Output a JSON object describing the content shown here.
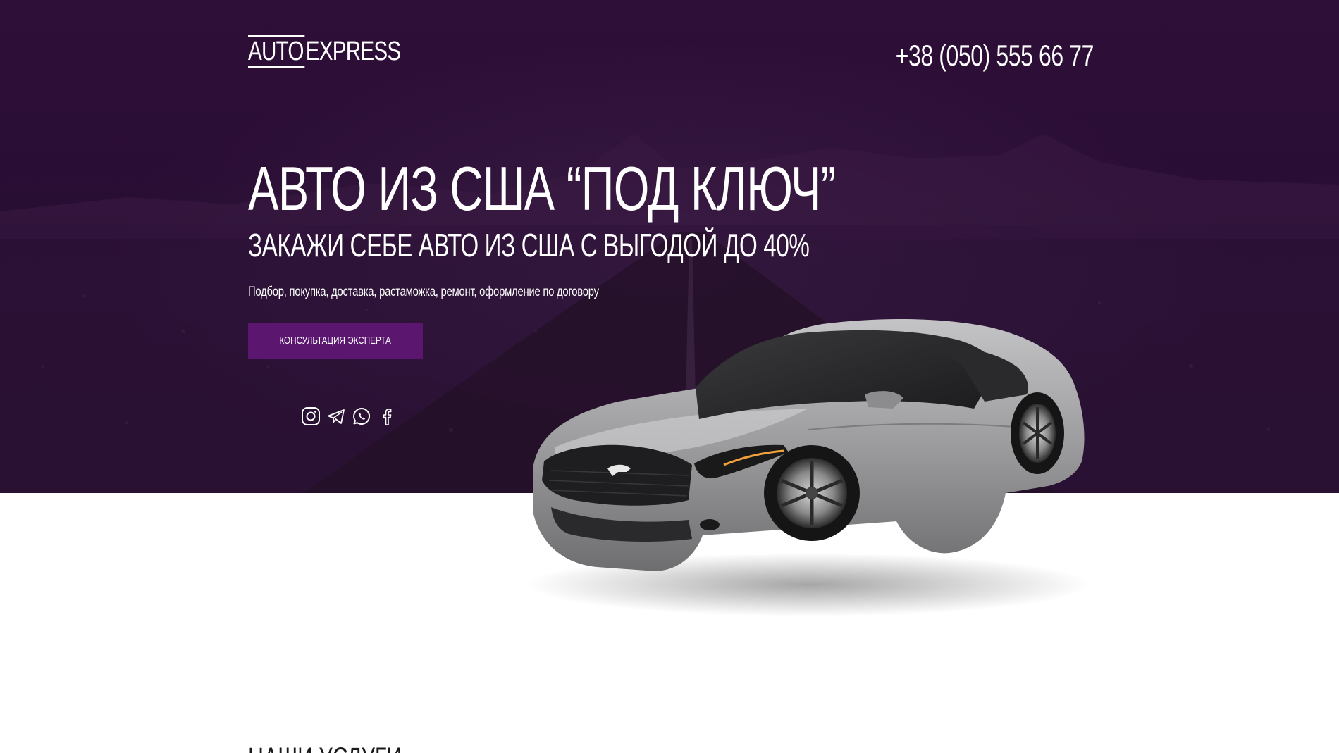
{
  "header": {
    "logo_part1": "AUTO ",
    "logo_part2": "EXPRESS",
    "phone": "+38 (050) 555 66 77"
  },
  "hero": {
    "title": "АВТО ИЗ США “ПОД КЛЮЧ”",
    "subtitle": "ЗАКАЖИ СЕБЕ АВТО ИЗ США С ВЫГОДОЙ ДО 40%",
    "description": "Подбор, покупка, доставка, растаможка, ремонт, оформление по договору",
    "cta_label": "КОНСУЛЬТАЦИЯ ЭКСПЕРТА"
  },
  "socials": [
    {
      "icon": "instagram-icon"
    },
    {
      "icon": "telegram-icon"
    },
    {
      "icon": "whatsapp-icon"
    },
    {
      "icon": "facebook-icon"
    }
  ],
  "services": {
    "title": "НАШИ УСЛУГИ"
  },
  "colors": {
    "hero_background": "#2a0d34",
    "accent_button": "#5b1670",
    "text_light": "#ffffff",
    "car_body": "#9a9a9c"
  }
}
